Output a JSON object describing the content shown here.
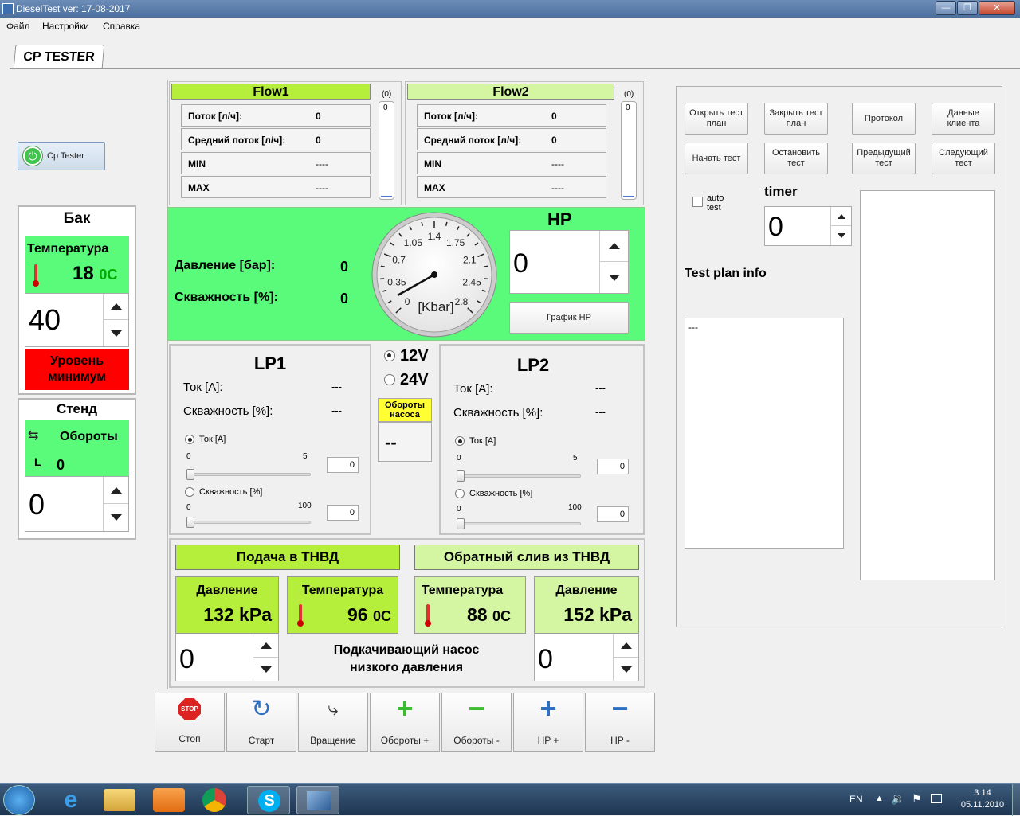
{
  "window": {
    "title": "DieselTest ver: 17-08-2017"
  },
  "menu": [
    "Файл",
    "Настройки",
    "Справка"
  ],
  "tab": "CP TESTER",
  "cp_button": "Cp Tester",
  "tank": {
    "title": "Бак",
    "temp_label": "Температура",
    "temp_value": "18",
    "temp_unit": "0C",
    "spin_value": "40",
    "alarm": "Уровень минимум"
  },
  "stand": {
    "title": "Стенд",
    "rpm_label": "Обороты",
    "l_label": "L",
    "l_value": "0",
    "spin_value": "0"
  },
  "flow1": {
    "title": "Flow1",
    "counter": "(0)",
    "bar_value": "0",
    "rows": [
      {
        "label": "Поток [л/ч]:",
        "value": "0"
      },
      {
        "label": "Средний поток [л/ч]:",
        "value": "0"
      },
      {
        "label": "MIN",
        "value": "----"
      },
      {
        "label": "MAX",
        "value": "----"
      }
    ]
  },
  "flow2": {
    "title": "Flow2",
    "counter": "(0)",
    "bar_value": "0",
    "rows": [
      {
        "label": "Поток [л/ч]:",
        "value": "0"
      },
      {
        "label": "Средний поток [л/ч]:",
        "value": "0"
      },
      {
        "label": "MIN",
        "value": "----"
      },
      {
        "label": "MAX",
        "value": "----"
      }
    ]
  },
  "hp_panel": {
    "pressure_label": "Давление [бар]:",
    "pressure_value": "0",
    "duty_label": "Скважность [%]:",
    "duty_value": "0",
    "title": "HP",
    "spin_value": "0",
    "graph_button": "График HP"
  },
  "gauge": {
    "unit": "[Kbar]",
    "ticks": [
      "0",
      "0.35",
      "0.7",
      "1.05",
      "1.4",
      "1.75",
      "2.1",
      "2.45",
      "2.8"
    ],
    "min": 0,
    "max": 2.8
  },
  "lp1": {
    "title": "LP1",
    "current_label": "Ток [А]:",
    "current_value": "---",
    "duty_label": "Скважность [%]:",
    "duty_value": "---",
    "radio_current": "Ток [A]",
    "radio_duty": "Скважность [%]",
    "s1_min": "0",
    "s1_max": "5",
    "s1_value": "0",
    "s2_min": "0",
    "s2_max": "100",
    "s2_value": "0"
  },
  "lp2": {
    "title": "LP2",
    "current_label": "Ток [А]:",
    "current_value": "---",
    "duty_label": "Скважность [%]:",
    "duty_value": "---",
    "radio_current": "Ток [A]",
    "radio_duty": "Скважность [%]",
    "s1_min": "0",
    "s1_max": "5",
    "s1_value": "0",
    "s2_min": "0",
    "s2_max": "100",
    "s2_value": "0"
  },
  "voltage": {
    "opt1": "12V",
    "opt2": "24V",
    "pump_rpm_label": "Обороты насоса",
    "pump_rpm_value": "--"
  },
  "supply": {
    "title": "Подача в ТНВД",
    "pressure_label": "Давление",
    "pressure_value": "132 kPa",
    "temp_label": "Температура",
    "temp_value": "96",
    "temp_unit": "0C",
    "spin_value": "0"
  },
  "return": {
    "title": "Обратный слив из ТНВД",
    "temp_label": "Температура",
    "temp_value": "88",
    "temp_unit": "0C",
    "pressure_label": "Давление",
    "pressure_value": "152 kPa",
    "spin_value": "0"
  },
  "pump_label": "Подкачивающий насос низкого давления",
  "toolbar": [
    "Стоп",
    "Старт",
    "Вращение",
    "Обороты +",
    "Обороты -",
    "HP +",
    "HP -"
  ],
  "right": {
    "btn_open": "Открыть тест план",
    "btn_close": "Закрыть тест план",
    "btn_protocol": "Протокол",
    "btn_client": "Данные клиента",
    "btn_start": "Начать тест",
    "btn_stop": "Остановить тест",
    "btn_prev": "Предыдущий тест",
    "btn_next": "Следующий тест",
    "auto_test": "auto test",
    "timer_label": "timer",
    "timer_value": "0",
    "plan_info_label": "Test plan info",
    "plan_info_value": "---"
  },
  "taskbar": {
    "lang": "EN",
    "time": "3:14",
    "date": "05.11.2010"
  },
  "colors": {
    "green": "#5afa7b",
    "lime": "#b6ee3c",
    "pale": "#d4f5a2",
    "red": "#ff0000"
  }
}
